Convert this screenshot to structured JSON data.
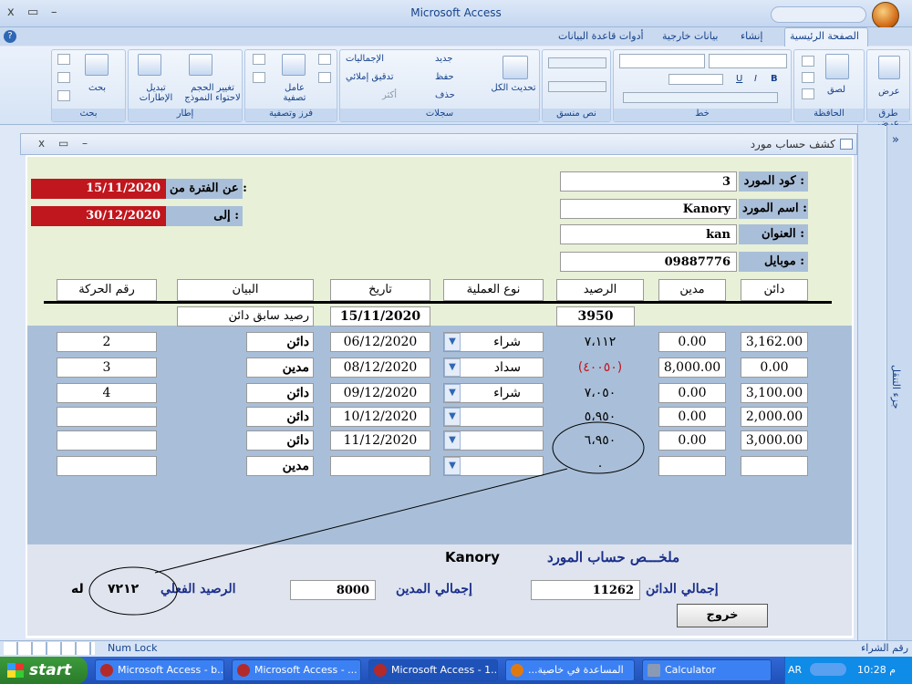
{
  "window": {
    "title": "Microsoft Access",
    "close_glyph": "x",
    "restore_glyph": "▭",
    "min_glyph": "–",
    "help_glyph": "?"
  },
  "ribbon_tabs": [
    "الصفحة الرئيسية",
    "إنشاء",
    "بيانات خارجية",
    "أدوات قاعدة البيانات"
  ],
  "ribbon": {
    "views": {
      "btn": "عرض",
      "group": "طرق عرض"
    },
    "clipboard": {
      "paste": "لصق",
      "group": "الحافظة"
    },
    "font": {
      "group": "خط",
      "bold": "B",
      "italic": "I",
      "underline": "U"
    },
    "rich_text": {
      "group": "نص منسق"
    },
    "records": {
      "refresh": "تحديث الكل",
      "new": "جديد",
      "save": "حفظ",
      "delete": "حذف",
      "totals": "الإجماليات",
      "spelling": "تدقيق إملائي",
      "more": "أكثر",
      "group": "سجلات"
    },
    "sort_filter": {
      "filter": "عامل تصفية",
      "group": "فرز وتصفية"
    },
    "window": {
      "size_to_fit": "تغيير الحجم لاحتواء النموذج",
      "switch": "تبديل الإطارات",
      "group": "إطار"
    },
    "find": {
      "find": "بحث",
      "group": "بحث"
    }
  },
  "form": {
    "title": "كشف حساب مورد",
    "header": {
      "supplier_code_label": "كود المورد :",
      "supplier_code": "3",
      "supplier_name_label": "اسم المورد :",
      "supplier_name": "Kanory",
      "address_label": "العنوان :",
      "address": "kan",
      "mobile_label": "موبايل :",
      "mobile": "09887776",
      "period_from_label": "عن الفترة من :",
      "period_from": "15/11/2020",
      "period_to_label": "إلى :",
      "period_to": "30/12/2020"
    },
    "columns": {
      "credit": "دائن",
      "debit": "مدين",
      "balance": "الرصيد",
      "op_type": "نوع العملية",
      "date": "تاريخ",
      "statement": "البيان",
      "move_no": "رقم الحركة"
    },
    "opening": {
      "balance": "3950",
      "date": "15/11/2020",
      "statement": "رصيد سابق دائن"
    },
    "rows": [
      {
        "credit": "3,162.00",
        "debit": "0.00",
        "balance": "٧،١١٢",
        "op_type": "شراء",
        "date": "06/12/2020",
        "statement": "دائن",
        "move_no": "2"
      },
      {
        "credit": "0.00",
        "debit": "8,000.00",
        "balance": "(٤٠٠٥٠)",
        "op_type": "سداد",
        "date": "08/12/2020",
        "statement": "مدين",
        "move_no": "3"
      },
      {
        "credit": "3,100.00",
        "debit": "0.00",
        "balance": "٧،٠٥٠",
        "op_type": "شراء",
        "date": "09/12/2020",
        "statement": "دائن",
        "move_no": "4"
      },
      {
        "credit": "2,000.00",
        "debit": "0.00",
        "balance": "٥،٩٥٠",
        "op_type": "",
        "date": "10/12/2020",
        "statement": "دائن",
        "move_no": ""
      },
      {
        "credit": "3,000.00",
        "debit": "0.00",
        "balance": "٦،٩٥٠",
        "op_type": "",
        "date": "11/12/2020",
        "statement": "دائن",
        "move_no": ""
      },
      {
        "credit": "",
        "debit": "",
        "balance": "٠",
        "op_type": "",
        "date": "",
        "statement": "مدين",
        "move_no": ""
      }
    ],
    "footer": {
      "summary_title": "ملخـــص حساب المورد",
      "summary_name": "Kanory",
      "total_credit_label": "إجمالي الدائن",
      "total_credit": "11262",
      "total_debit_label": "إجمالي المدين",
      "total_debit": "8000",
      "actual_balance_label": "الرصيد الفعلي",
      "actual_balance": "٧٢١٢",
      "actual_suffix": "له",
      "exit": "خروج"
    }
  },
  "nav_pane": {
    "label": "جزء التنقل",
    "collapse": "»"
  },
  "status": {
    "left": "رقم الشراء",
    "num_lock": "Num Lock"
  },
  "taskbar": {
    "start": "start",
    "tasks": [
      "Microsoft Access - b...",
      "Microsoft Access - ...",
      "Microsoft Access - 1...",
      "...المساعدة في خاصية",
      "Calculator"
    ],
    "lang": "AR",
    "clock": "10:28 م"
  },
  "colors": {
    "red_field": "#c0161d",
    "header_bg": "#e8f0d8",
    "detail_bg": "#a9bfd9",
    "negative": "#c0161d"
  }
}
